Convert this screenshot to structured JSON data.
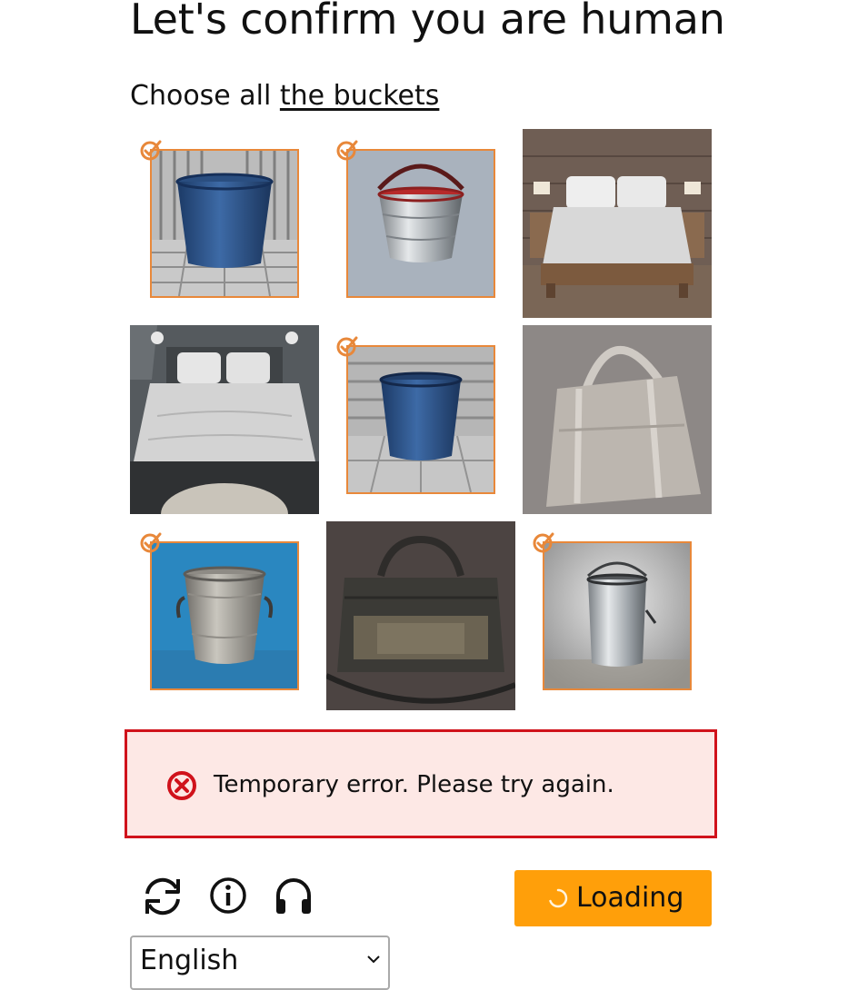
{
  "title": "Let's confirm you are human",
  "instruction": {
    "prefix": "Choose all ",
    "target": "the buckets"
  },
  "grid": {
    "tiles": [
      {
        "subject": "blue metal bucket on wooden deck",
        "selected": true
      },
      {
        "subject": "galvanized bucket with red handle",
        "selected": true
      },
      {
        "subject": "bed on wooden platform",
        "selected": false
      },
      {
        "subject": "bed with white linens",
        "selected": false
      },
      {
        "subject": "blue plastic bucket",
        "selected": true
      },
      {
        "subject": "grey tote bag",
        "selected": false
      },
      {
        "subject": "galvanized bucket on blue background",
        "selected": true
      },
      {
        "subject": "dark duffel bag",
        "selected": false
      },
      {
        "subject": "steel paint bucket",
        "selected": true
      }
    ]
  },
  "error": {
    "message": "Temporary error. Please try again.",
    "icon": "error-x-circle-icon",
    "color": "#d0121b",
    "background": "#fde8e5"
  },
  "toolbar": {
    "icons": [
      "refresh-icon",
      "info-icon",
      "audio-icon"
    ]
  },
  "submit": {
    "label": "Loading",
    "color": "#ff9f0a"
  },
  "language": {
    "selected": "English"
  },
  "colors": {
    "accent": "#e8883a"
  }
}
